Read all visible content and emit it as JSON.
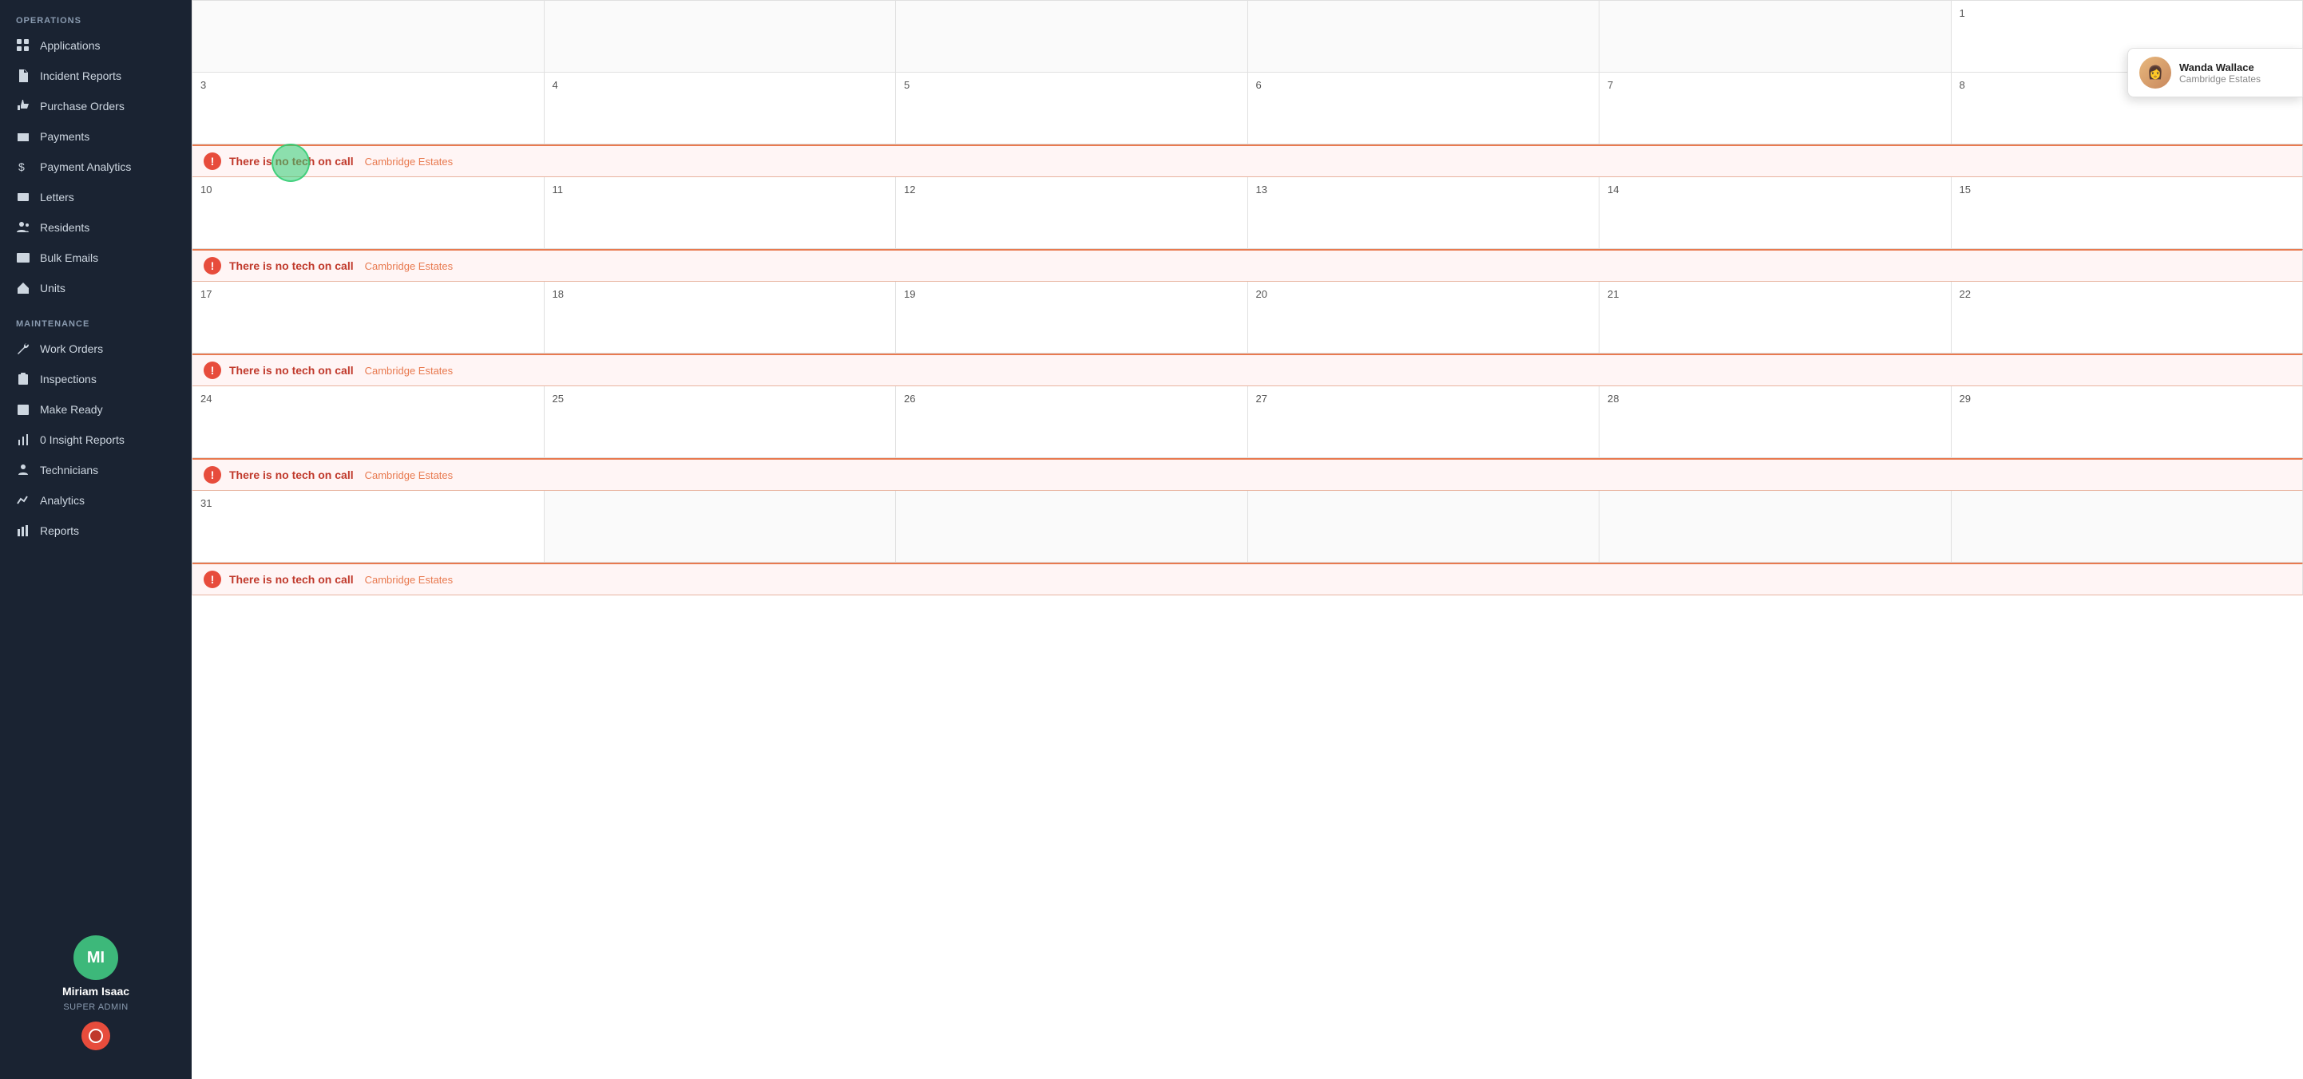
{
  "sidebar": {
    "operations_label": "OPERATIONS",
    "maintenance_label": "MAINTENANCE",
    "items_operations": [
      {
        "id": "applications",
        "label": "Applications",
        "icon": "grid"
      },
      {
        "id": "incident-reports",
        "label": "Incident Reports",
        "icon": "file"
      },
      {
        "id": "purchase-orders",
        "label": "Purchase Orders",
        "icon": "thumbsup"
      },
      {
        "id": "payments",
        "label": "Payments",
        "icon": "camera"
      },
      {
        "id": "payment-analytics",
        "label": "Payment Analytics",
        "icon": "dollar"
      },
      {
        "id": "letters",
        "label": "Letters",
        "icon": "letter"
      },
      {
        "id": "residents",
        "label": "Residents",
        "icon": "people"
      },
      {
        "id": "bulk-emails",
        "label": "Bulk Emails",
        "icon": "email"
      },
      {
        "id": "units",
        "label": "Units",
        "icon": "home"
      }
    ],
    "items_maintenance": [
      {
        "id": "work-orders",
        "label": "Work Orders",
        "icon": "wrench"
      },
      {
        "id": "inspections",
        "label": "Inspections",
        "icon": "clipboard"
      },
      {
        "id": "make-ready",
        "label": "Make Ready",
        "icon": "calendar"
      },
      {
        "id": "insight-reports",
        "label": "0 Insight Reports",
        "icon": "chart"
      },
      {
        "id": "technicians",
        "label": "Technicians",
        "icon": "people2"
      },
      {
        "id": "analytics",
        "label": "Analytics",
        "icon": "bar"
      },
      {
        "id": "reports",
        "label": "Reports",
        "icon": "bar2"
      }
    ]
  },
  "user": {
    "initials": "MI",
    "name": "Miriam Isaac",
    "role": "SUPER ADMIN"
  },
  "calendar": {
    "weeks": [
      {
        "days": [
          {
            "number": "",
            "empty": true
          },
          {
            "number": "",
            "empty": true
          },
          {
            "number": "",
            "empty": true
          },
          {
            "number": "",
            "empty": true
          },
          {
            "number": "",
            "empty": true
          },
          {
            "number": "1",
            "empty": false
          }
        ],
        "alert": null
      },
      {
        "days": [
          {
            "number": "3",
            "empty": false
          },
          {
            "number": "4",
            "empty": false
          },
          {
            "number": "5",
            "empty": false
          },
          {
            "number": "6",
            "empty": false
          },
          {
            "number": "7",
            "empty": false
          },
          {
            "number": "8",
            "empty": false
          }
        ],
        "alert": {
          "text": "There is no tech on call",
          "sub": "Cambridge Estates"
        }
      },
      {
        "days": [
          {
            "number": "10",
            "empty": false
          },
          {
            "number": "11",
            "empty": false
          },
          {
            "number": "12",
            "empty": false
          },
          {
            "number": "13",
            "empty": false
          },
          {
            "number": "14",
            "empty": false
          },
          {
            "number": "15",
            "empty": false
          }
        ],
        "alert": {
          "text": "There is no tech on call",
          "sub": "Cambridge Estates"
        }
      },
      {
        "days": [
          {
            "number": "17",
            "empty": false
          },
          {
            "number": "18",
            "empty": false
          },
          {
            "number": "19",
            "empty": false
          },
          {
            "number": "20",
            "empty": false
          },
          {
            "number": "21",
            "empty": false
          },
          {
            "number": "22",
            "empty": false
          }
        ],
        "alert": {
          "text": "There is no tech on call",
          "sub": "Cambridge Estates"
        }
      },
      {
        "days": [
          {
            "number": "24",
            "empty": false
          },
          {
            "number": "25",
            "empty": false
          },
          {
            "number": "26",
            "empty": false
          },
          {
            "number": "27",
            "empty": false
          },
          {
            "number": "28",
            "empty": false
          },
          {
            "number": "29",
            "empty": false
          }
        ],
        "alert": {
          "text": "There is no tech on call",
          "sub": "Cambridge Estates"
        }
      },
      {
        "days": [
          {
            "number": "31",
            "empty": false
          },
          {
            "number": "",
            "empty": true
          },
          {
            "number": "",
            "empty": true
          },
          {
            "number": "",
            "empty": true
          },
          {
            "number": "",
            "empty": true
          },
          {
            "number": "",
            "empty": true
          }
        ],
        "alert": {
          "text": "There is no tech on call",
          "sub": "Cambridge Estates"
        }
      }
    ]
  },
  "popup": {
    "name": "Wanda Wallace",
    "sub": "Cambridge Estates"
  },
  "alerts": {
    "text": "There is no tech on call",
    "sub": "Cambridge Estates"
  }
}
